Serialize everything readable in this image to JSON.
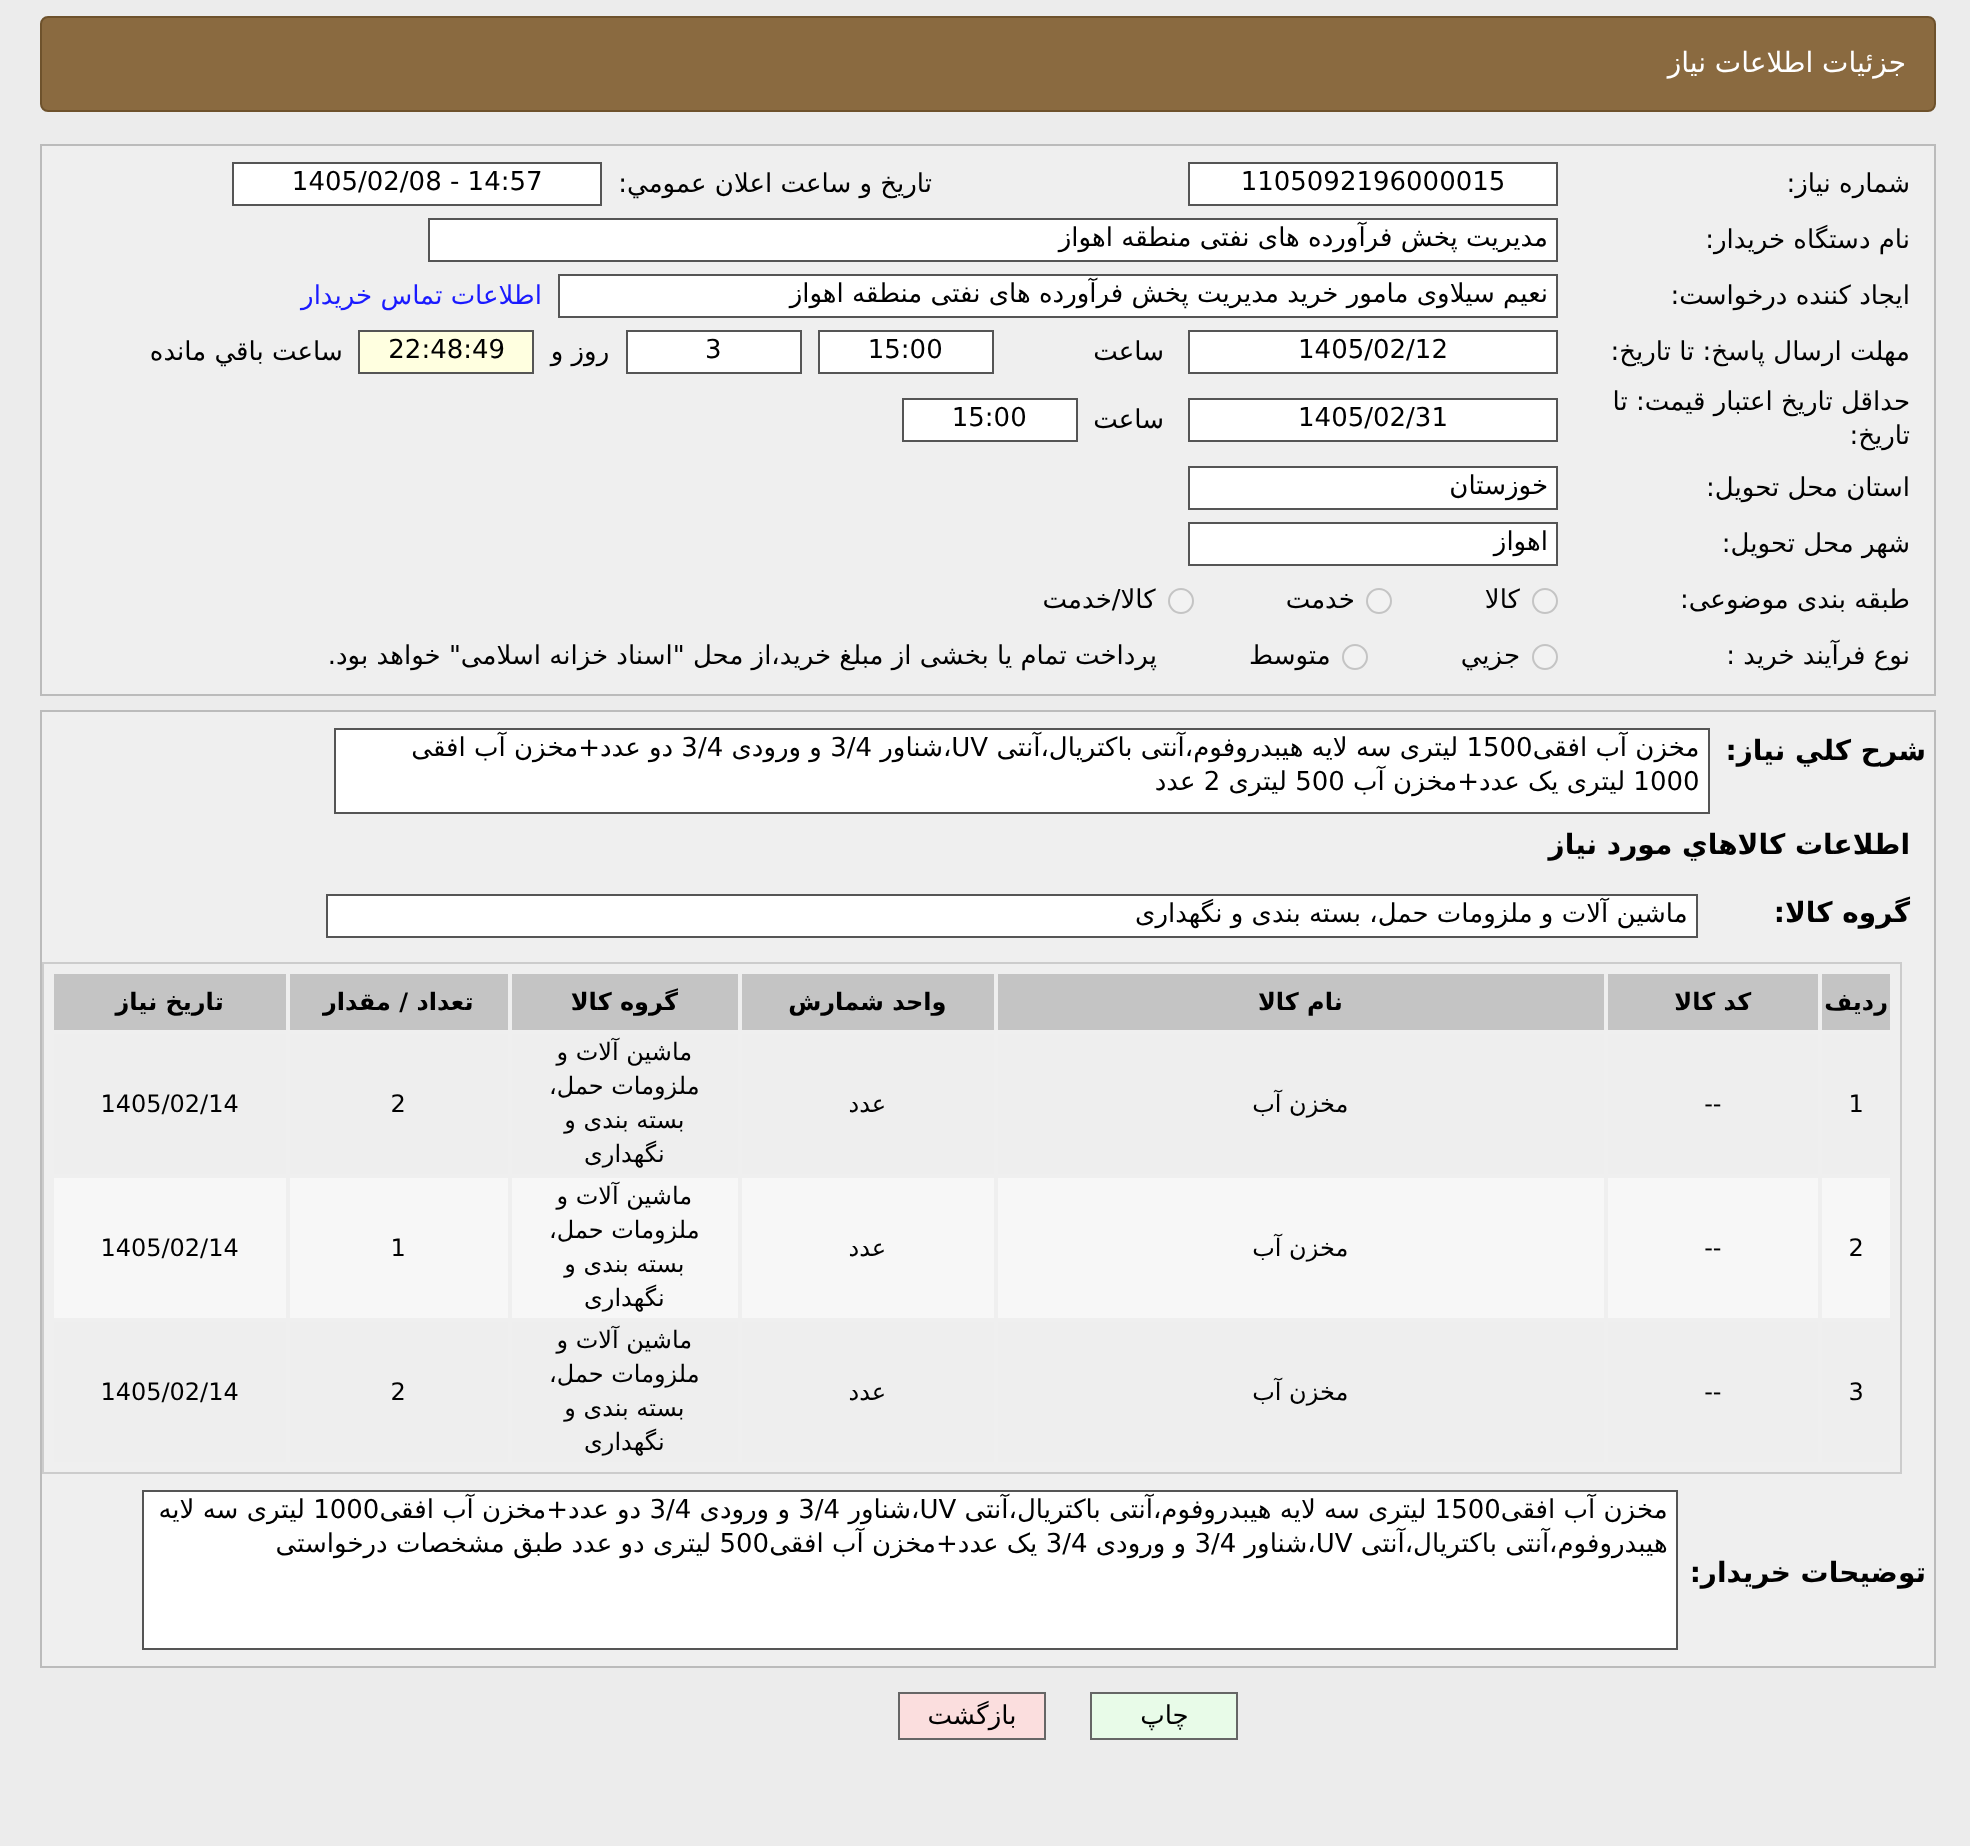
{
  "header": {
    "title": "جزئیات اطلاعات نیاز"
  },
  "details": {
    "need_number": {
      "label": "شماره نیاز:",
      "value": "1105092196000015"
    },
    "announce": {
      "label": "تاريخ و ساعت اعلان عمومي:",
      "value": "1405/02/08 - 14:57"
    },
    "buyer_org": {
      "label": "نام دستگاه خریدار:",
      "value": "مدیریت پخش فرآورده های نفتی منطقه اهواز"
    },
    "requester": {
      "label": "ایجاد کننده درخواست:",
      "value": "نعیم سیلاوی مامور خرید مدیریت پخش فرآورده های نفتی منطقه اهواز",
      "link": "اطلاعات تماس خریدار"
    },
    "response_deadline": {
      "label": "مهلت ارسال پاسخ: تا تاریخ:",
      "date": "1405/02/12",
      "time_label": "ساعت",
      "time": "15:00",
      "days": "3",
      "days_label": "روز و",
      "remaining": "22:48:49",
      "remaining_label": "ساعت باقي مانده"
    },
    "price_validity": {
      "label": "حداقل تاریخ اعتبار قیمت: تا تاریخ:",
      "date": "1405/02/31",
      "time_label": "ساعت",
      "time": "15:00"
    },
    "province": {
      "label": "استان محل تحویل:",
      "value": "خوزستان"
    },
    "city": {
      "label": "شهر محل تحویل:",
      "value": "اهواز"
    },
    "category": {
      "label": "طبقه بندی موضوعی:",
      "options": [
        {
          "label": "کالا",
          "selected": false
        },
        {
          "label": "خدمت",
          "selected": false
        },
        {
          "label": "کالا/خدمت",
          "selected": false
        }
      ]
    },
    "purchase_process": {
      "label": "نوع فرآیند خرید :",
      "options": [
        {
          "label": "جزيي",
          "selected": false
        },
        {
          "label": "متوسط",
          "selected": false
        }
      ],
      "note": "پرداخت تمام یا بخشی از مبلغ خرید،از محل \"اسناد خزانه اسلامی\" خواهد بود."
    }
  },
  "summary": {
    "label": "شرح کلي نياز:",
    "value": "مخزن آب افقی1500 لیتری سه لایه  هیبدروفوم،آنتی باکتریال،آنتی UV،شناور 3/4  و ورودی 3/4 دو عدد+مخزن آب افقی 1000 لیتری یک عدد+مخزن آب 500 لیتری 2 عدد"
  },
  "goods_info_title": "اطلاعات کالاهاي مورد نياز",
  "goods_group": {
    "label": "گروه کالا:",
    "value": "ماشین آلات و ملزومات حمل، بسته بندی و نگهداری"
  },
  "table": {
    "columns": [
      "ردیف",
      "کد کالا",
      "نام کالا",
      "واحد شمارش",
      "گروه کالا",
      "تعداد / مقدار",
      "تاریخ نیاز"
    ],
    "rows": [
      [
        "1",
        "--",
        "مخزن آب",
        "عدد",
        "ماشین آلات و ملزومات حمل، بسته بندی و نگهداری",
        "2",
        "1405/02/14"
      ],
      [
        "2",
        "--",
        "مخزن آب",
        "عدد",
        "ماشین آلات و ملزومات حمل، بسته بندی و نگهداری",
        "1",
        "1405/02/14"
      ],
      [
        "3",
        "--",
        "مخزن آب",
        "عدد",
        "ماشین آلات و ملزومات حمل، بسته بندی و نگهداری",
        "2",
        "1405/02/14"
      ]
    ]
  },
  "buyer_notes": {
    "label": "توضیحات خریدار:",
    "value": "مخزن آب افقی1500 لیتری سه لایه  هیبدروفوم،آنتی باکتریال،آنتی UV،شناور 3/4  و ورودی 3/4 دو عدد+مخزن آب افقی1000 لیتری سه لایه  هیبدروفوم،آنتی باکتریال،آنتی UV،شناور 3/4  و ورودی 3/4 یک عدد+مخزن آب افقی500 لیتری دو عدد  طبق مشخصات درخواستی"
  },
  "buttons": [
    {
      "label": "چاپ",
      "kind": "print"
    },
    {
      "label": "بازگشت",
      "kind": "back"
    }
  ]
}
